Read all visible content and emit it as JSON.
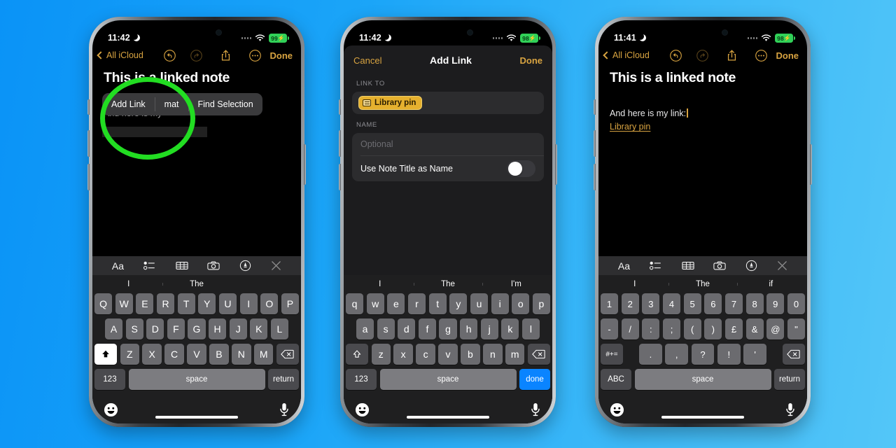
{
  "background": {
    "color_left": "#0a93f7",
    "color_right": "#53c6f8"
  },
  "annotation": {
    "shape": "green-circle",
    "color": "#22dd22",
    "target": "Add Link"
  },
  "phones": [
    {
      "id": "phone-1",
      "status": {
        "time": "11:42",
        "dnd_icon": "crescent-moon-icon",
        "wifi_icon": "wifi-icon",
        "battery": "99",
        "charging": true
      },
      "app": "Notes",
      "toolbar": {
        "back_label": "All iCloud",
        "undo_icon": "undo-icon",
        "redo_icon": "redo-icon",
        "share_icon": "share-icon",
        "more_icon": "more-ellipsis-icon",
        "done_label": "Done"
      },
      "note": {
        "title": "This is a linked note",
        "body": "And here is my"
      },
      "context_menu": {
        "items": [
          "Add Link",
          "mat",
          "Find Selection"
        ]
      },
      "format_bar": [
        "Aa",
        "checklist-icon",
        "table-icon",
        "camera-icon",
        "markup-pen-icon",
        "close-icon"
      ],
      "keyboard": {
        "type": "letters-uppercase",
        "suggestions": [
          "I",
          "The",
          ""
        ],
        "row1": [
          "Q",
          "W",
          "E",
          "R",
          "T",
          "Y",
          "U",
          "I",
          "O",
          "P"
        ],
        "row2": [
          "A",
          "S",
          "D",
          "F",
          "G",
          "H",
          "J",
          "K",
          "L"
        ],
        "row3": [
          "Z",
          "X",
          "C",
          "V",
          "B",
          "N",
          "M"
        ],
        "shift_icon": "shift-icon-active",
        "backspace_icon": "backspace-icon",
        "num_label": "123",
        "space_label": "space",
        "action_label": "return",
        "action_style": "dark",
        "emoji_icon": "emoji-icon",
        "mic_icon": "microphone-icon"
      }
    },
    {
      "id": "phone-2",
      "status": {
        "time": "11:42",
        "dnd_icon": "crescent-moon-icon",
        "wifi_icon": "wifi-icon",
        "battery": "98",
        "charging": true
      },
      "app": "Notes",
      "sheet": {
        "cancel_label": "Cancel",
        "title": "Add Link",
        "done_label": "Done",
        "link_to_label": "LINK TO",
        "link_chip": {
          "text": "Library pin",
          "icon": "note-icon",
          "color": "#e5b02e"
        },
        "name_label": "NAME",
        "name_placeholder": "Optional",
        "name_value": "",
        "toggle_label": "Use Note Title as Name",
        "toggle_state": "off"
      },
      "keyboard": {
        "type": "letters-lowercase",
        "suggestions": [
          "I",
          "The",
          "I'm"
        ],
        "row1": [
          "q",
          "w",
          "e",
          "r",
          "t",
          "y",
          "u",
          "i",
          "o",
          "p"
        ],
        "row2": [
          "a",
          "s",
          "d",
          "f",
          "g",
          "h",
          "j",
          "k",
          "l"
        ],
        "row3": [
          "z",
          "x",
          "c",
          "v",
          "b",
          "n",
          "m"
        ],
        "shift_icon": "shift-icon",
        "backspace_icon": "backspace-icon",
        "num_label": "123",
        "space_label": "space",
        "action_label": "done",
        "action_style": "blue",
        "emoji_icon": "emoji-icon",
        "mic_icon": "microphone-icon"
      }
    },
    {
      "id": "phone-3",
      "status": {
        "time": "11:41",
        "dnd_icon": "crescent-moon-icon",
        "wifi_icon": "wifi-icon",
        "battery": "98",
        "charging": true
      },
      "app": "Notes",
      "toolbar": {
        "back_label": "All iCloud",
        "undo_icon": "undo-icon",
        "redo_icon": "redo-icon",
        "share_icon": "share-icon",
        "more_icon": "more-ellipsis-icon",
        "done_label": "Done"
      },
      "note": {
        "title": "This is a linked note",
        "body": "And here is my link:",
        "link_text": "Library pin"
      },
      "format_bar": [
        "Aa",
        "checklist-icon",
        "table-icon",
        "camera-icon",
        "markup-pen-icon",
        "close-icon"
      ],
      "keyboard": {
        "type": "numbers-symbols",
        "suggestions": [
          "I",
          "The",
          "if"
        ],
        "row1": [
          "1",
          "2",
          "3",
          "4",
          "5",
          "6",
          "7",
          "8",
          "9",
          "0"
        ],
        "row2": [
          "-",
          "/",
          ":",
          ";",
          "(",
          ")",
          "£",
          "&",
          "@",
          "\""
        ],
        "row3": [
          "#+=",
          ".",
          ",",
          "?",
          "!",
          "'"
        ],
        "backspace_icon": "backspace-icon",
        "num_label": "ABC",
        "space_label": "space",
        "action_label": "return",
        "action_style": "dark",
        "emoji_icon": "emoji-icon",
        "mic_icon": "microphone-icon"
      }
    }
  ]
}
